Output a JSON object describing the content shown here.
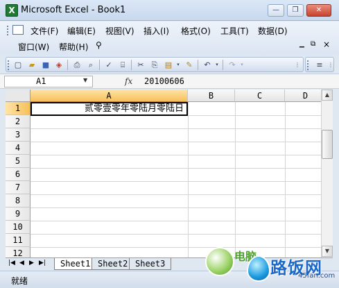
{
  "window": {
    "title": "Microsoft Excel - Book1",
    "app_icon": "X",
    "minimize_icon": "—",
    "restore_icon": "❐",
    "close_icon": "✕"
  },
  "menu": {
    "row1": [
      "文件(F)",
      "编辑(E)",
      "视图(V)",
      "插入(I)",
      "格式(O)",
      "工具(T)",
      "数据(D)"
    ],
    "row2": [
      "窗口(W)",
      "帮助(H)"
    ]
  },
  "formula_bar": {
    "name_box": "A1",
    "fx_label": "fx",
    "value": "20100606"
  },
  "grid": {
    "columns": [
      "A",
      "B",
      "C",
      "D"
    ],
    "rows": [
      "1",
      "2",
      "3",
      "4",
      "5",
      "6",
      "7",
      "8",
      "9",
      "10",
      "11",
      "12"
    ],
    "cell_A1": "贰零壹零年零陆月零陆日"
  },
  "sheets": [
    "Sheet1",
    "Sheet2",
    "Sheet3"
  ],
  "status": {
    "text": "就绪"
  },
  "watermark": {
    "brand": "路饭网",
    "site": "45fan.com",
    "partial": "电脑"
  },
  "colors": {
    "accent": "#f6c05a",
    "excel_green": "#1e7b34"
  }
}
